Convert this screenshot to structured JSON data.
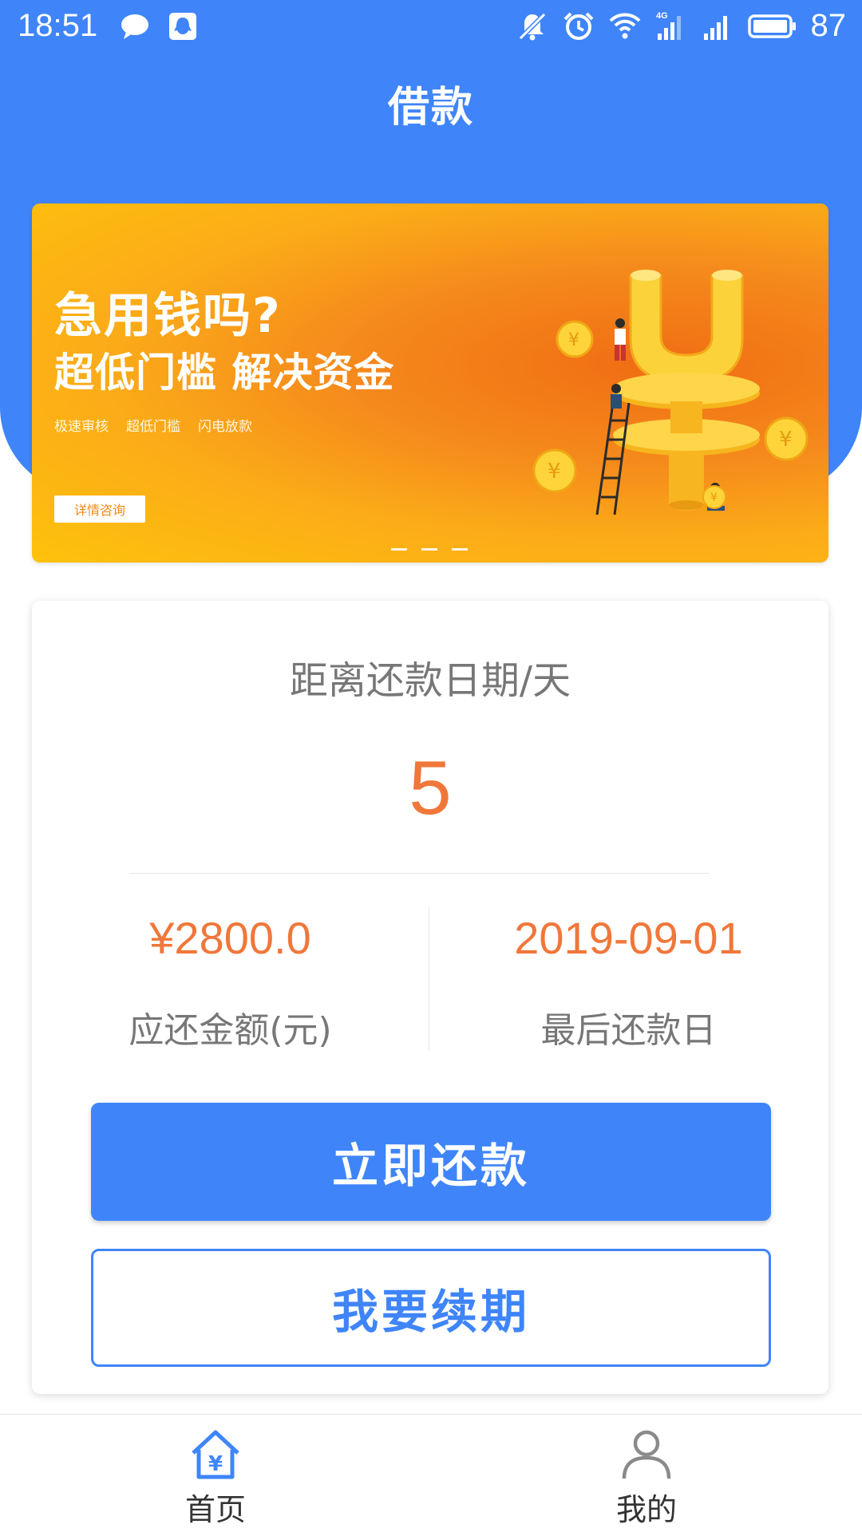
{
  "status_bar": {
    "time": "18:51",
    "battery": "87",
    "icons": [
      "message-icon",
      "qq-icon",
      "mute-icon",
      "alarm-icon",
      "wifi-icon",
      "signal-4g-icon",
      "signal-icon",
      "battery-icon"
    ]
  },
  "header": {
    "title": "借款"
  },
  "banner": {
    "title": "急用钱吗?",
    "subtitle": "超低门槛 解决资金",
    "tags": [
      "极速审核",
      "超低门槛",
      "闪电放款"
    ],
    "button_label": "详情咨询",
    "page_count": 3
  },
  "repayment": {
    "title": "距离还款日期/天",
    "days_left": "5",
    "amount": "¥2800.0",
    "amount_label": "应还金额(元)",
    "due_date": "2019-09-01",
    "due_date_label": "最后还款日",
    "repay_button": "立即还款",
    "renew_button": "我要续期"
  },
  "bottom_nav": {
    "items": [
      {
        "label": "首页",
        "icon": "home-yuan-icon",
        "active": true
      },
      {
        "label": "我的",
        "icon": "user-icon",
        "active": false
      }
    ]
  },
  "colors": {
    "primary": "#3f85f9",
    "accent": "#f0773a",
    "banner_yellow": "#fec20c",
    "banner_orange": "#f06d13"
  }
}
